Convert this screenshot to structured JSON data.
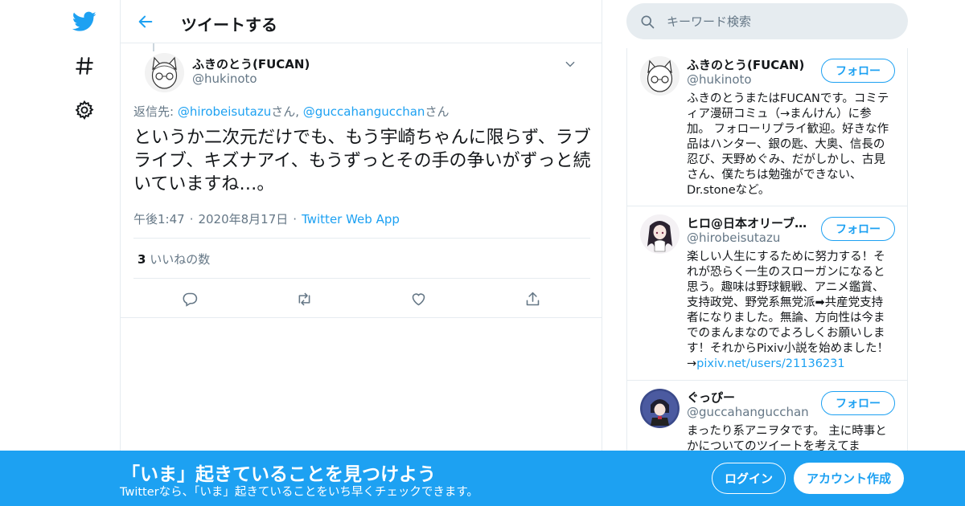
{
  "colors": {
    "accent": "#1da1f2",
    "text": "#14171a",
    "muted": "#657786",
    "border": "#e6ecf0"
  },
  "nav": {
    "icons": [
      "twitter-logo-icon",
      "hashtag-icon",
      "gear-icon"
    ]
  },
  "header": {
    "title": "ツイートする",
    "back_icon": "arrow-left-icon"
  },
  "tweet": {
    "author_name": "ふきのとう(FUCAN)",
    "author_handle": "@hukinoto",
    "reply_prefix": "返信先: ",
    "reply_user1": "@hirobeisutazu",
    "reply_san1": "さん",
    "reply_sep": ", ",
    "reply_user2": "@guccahangucchan",
    "reply_san2": "さん",
    "text": "というか二次元だけでも、もう宇崎ちゃんに限らず、ラブライブ、キズナアイ、もうずっとその手の争いがずっと続いていますね…。",
    "time": "午後1:47",
    "dot": "·",
    "date": "2020年8月17日",
    "app": "Twitter Web App",
    "likes_count": "3",
    "likes_label": "いいねの数"
  },
  "search": {
    "placeholder": "キーワード検索"
  },
  "users": [
    {
      "name": "ふきのとう(FUCAN)",
      "handle": "@hukinoto",
      "follow": "フォロー",
      "bio": "ふきのとうまたはFUCANです。コミティア漫研コミュ（→まんけん）に参加。 フォローリプライ歓迎。好きな作品はハンター、銀の匙、大奥、信長の忍び、天野めぐみ、だがしかし、古見さん、僕たちは勉強ができない、Dr.stoneなど。"
    },
    {
      "name": "ヒロ@日本オリーブ…",
      "handle": "@hirobeisutazu",
      "follow": "フォロー",
      "bio": "楽しい人生にするために努力する！それが恐らく一生のスローガンになると思う。趣味は野球観戦、アニメ鑑賞、支持政党、野党系無党派➡共産党支持者になりました。無論、方向性は今までのまんまなのでよろしくお願いします！それからPixiv小説を始めました！→",
      "bio_link": "pixiv.net/users/21136231"
    },
    {
      "name": "ぐっぴー",
      "handle": "@guccahangucchan",
      "follow": "フォロー",
      "bio": "まったり系アニヲタです。 主に時事とかについてのツイートを考えてま"
    }
  ],
  "banner": {
    "title": "「いま」起きていることを見つけよう",
    "subtitle": "Twitterなら、「いま」起きていることをいち早くチェックできます。",
    "login": "ログイン",
    "signup": "アカウント作成"
  }
}
